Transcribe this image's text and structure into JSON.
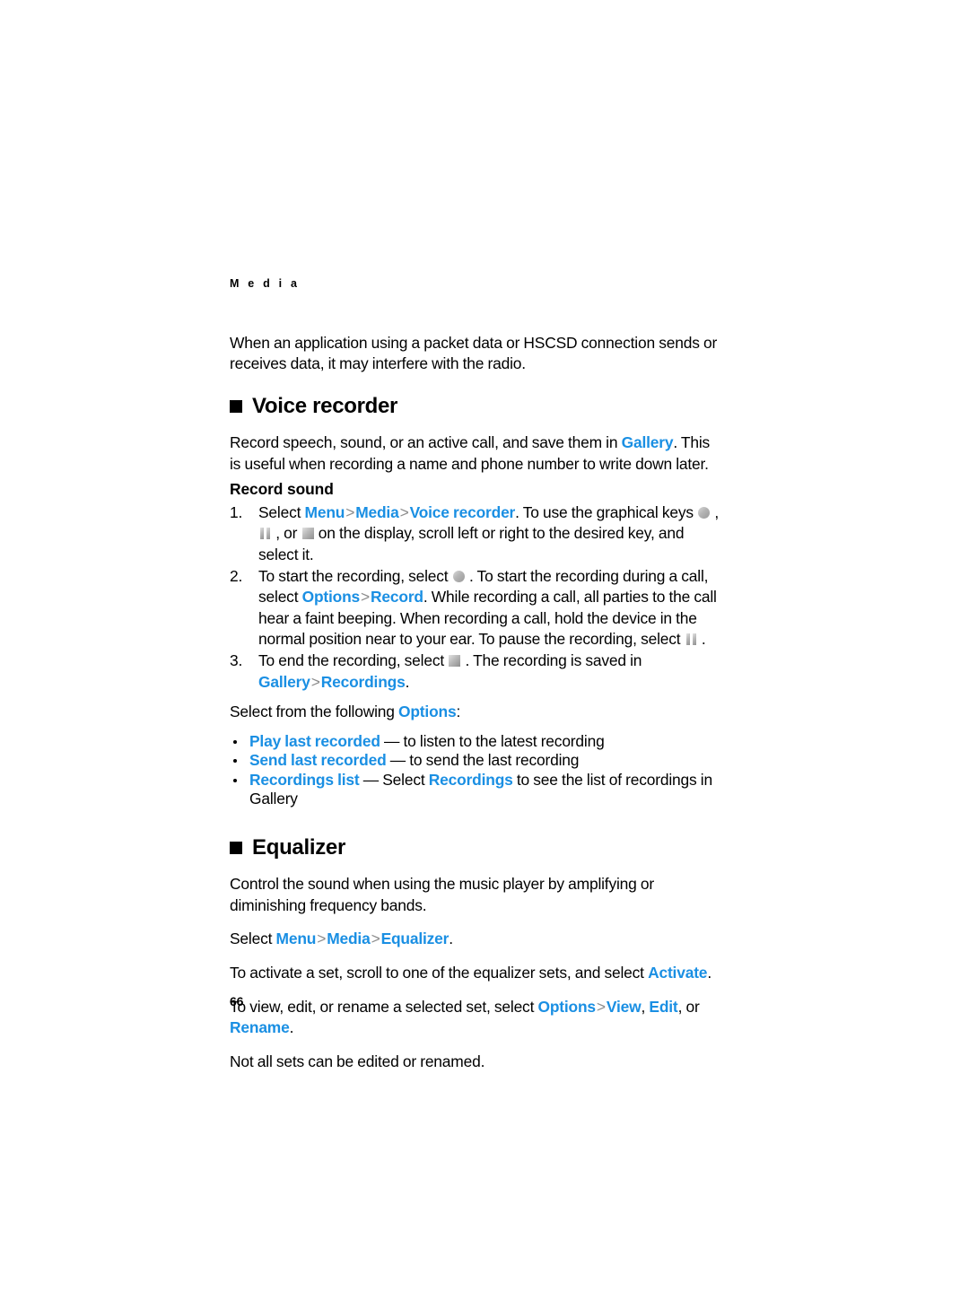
{
  "document": {
    "running_header": "M e d i a",
    "page_number": "66",
    "link_color": "#1a8fe3",
    "separator": ">"
  },
  "intro": {
    "paragraph": "When an application using a packet data or HSCSD connection sends or receives data, it may interfere with the radio."
  },
  "voice_recorder": {
    "heading": "Voice recorder",
    "intro_before": "Record speech, sound, or an active call, and save them in ",
    "intro_link": "Gallery",
    "intro_after": ". This is useful when recording a name and phone number to write down later.",
    "subheading": "Record sound",
    "steps": [
      {
        "number": "1.",
        "t1": "Select ",
        "l1": "Menu",
        "t2": "",
        "l2": "Media",
        "t3": "",
        "l3": "Voice recorder",
        "t4": ". To use the graphical keys ",
        "icon1": "record-icon",
        "t5": " , ",
        "icon2": "pause-icon",
        "t6": " , or ",
        "icon3": "stop-icon",
        "t7": " on the display, scroll left or right to the desired key, and select it."
      },
      {
        "number": "2.",
        "t1": "To start the recording, select ",
        "icon1": "record-icon",
        "t2": " . To start the recording during a call, select ",
        "l1": "Options",
        "t3": "",
        "l2": "Record",
        "t4": ". While recording a call, all parties to the call hear a faint beeping. When recording a call, hold the device in the normal position near to your ear. To pause the recording, select ",
        "icon2": "pause-icon",
        "t5": " ."
      },
      {
        "number": "3.",
        "t1": "To end the recording, select ",
        "icon1": "stop-icon",
        "t2": " . The recording is saved in ",
        "l1": "Gallery",
        "t3": "",
        "l2": "Recordings",
        "t4": "."
      }
    ],
    "options_lead_before": "Select from the following ",
    "options_lead_link": "Options",
    "options_lead_after": ":",
    "options": [
      {
        "label": "Play last recorded",
        "dash": " — ",
        "desc": " to listen to the latest recording"
      },
      {
        "label": "Send last recorded",
        "dash": " — ",
        "desc": " to send the last recording"
      },
      {
        "label": "Recordings list ",
        "dash": " — ",
        "desc_before": "Select ",
        "desc_link": "Recordings",
        "desc_after": " to see the list of recordings in Gallery"
      }
    ]
  },
  "equalizer": {
    "heading": "Equalizer",
    "intro": "Control the sound when using the music player by amplifying or diminishing frequency bands.",
    "select_path": {
      "t1": "Select ",
      "l1": "Menu",
      "l2": "Media",
      "l3": "Equalizer",
      "t2": "."
    },
    "activate": {
      "t1": "To activate a set, scroll to one of the equalizer sets, and select ",
      "l1": "Activate",
      "t2": "."
    },
    "view_edit": {
      "t1": "To view, edit, or rename a selected set, select ",
      "l1": "Options",
      "l2": "View",
      "t2": ", ",
      "l3": "Edit",
      "t3": ", or ",
      "l4": "Rename",
      "t4": "."
    },
    "note": "Not all sets can be edited or renamed."
  }
}
